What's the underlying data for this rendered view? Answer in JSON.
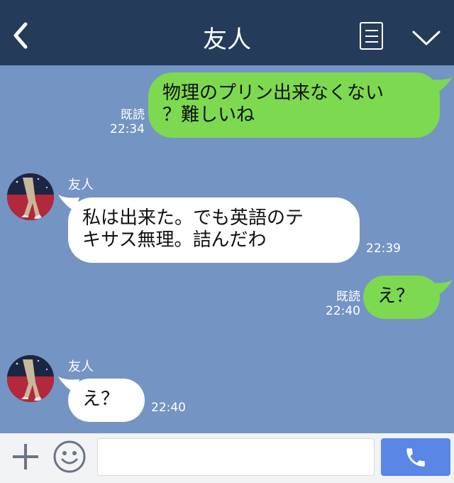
{
  "header": {
    "title": "友人"
  },
  "messages": [
    {
      "dir": "out",
      "text_line1": "物理のプリン出来なくない",
      "text_line2": "？難しいね",
      "read": "既読",
      "time": "22:34"
    },
    {
      "dir": "in",
      "sender": "友人",
      "text_line1": "私は出来た。でも英語のテ",
      "text_line2": "キサス無理。詰んだわ",
      "time": "22:39"
    },
    {
      "dir": "out",
      "text": "え？",
      "read": "既読",
      "time": "22:40"
    },
    {
      "dir": "in",
      "sender": "友人",
      "text": "え？",
      "time": "22:40"
    }
  ],
  "colors": {
    "header_bg": "#243b5a",
    "chat_bg": "#7494c3",
    "outgoing_bubble": "#7dd950",
    "incoming_bubble": "#ffffff",
    "call_button": "#5a86e6"
  },
  "icons": {
    "back": "back-chevron-icon",
    "notes": "document-icon",
    "collapse": "chevron-down-icon",
    "add": "plus-icon",
    "sticker": "emoji-icon",
    "call": "phone-icon"
  },
  "composer": {
    "value": ""
  }
}
